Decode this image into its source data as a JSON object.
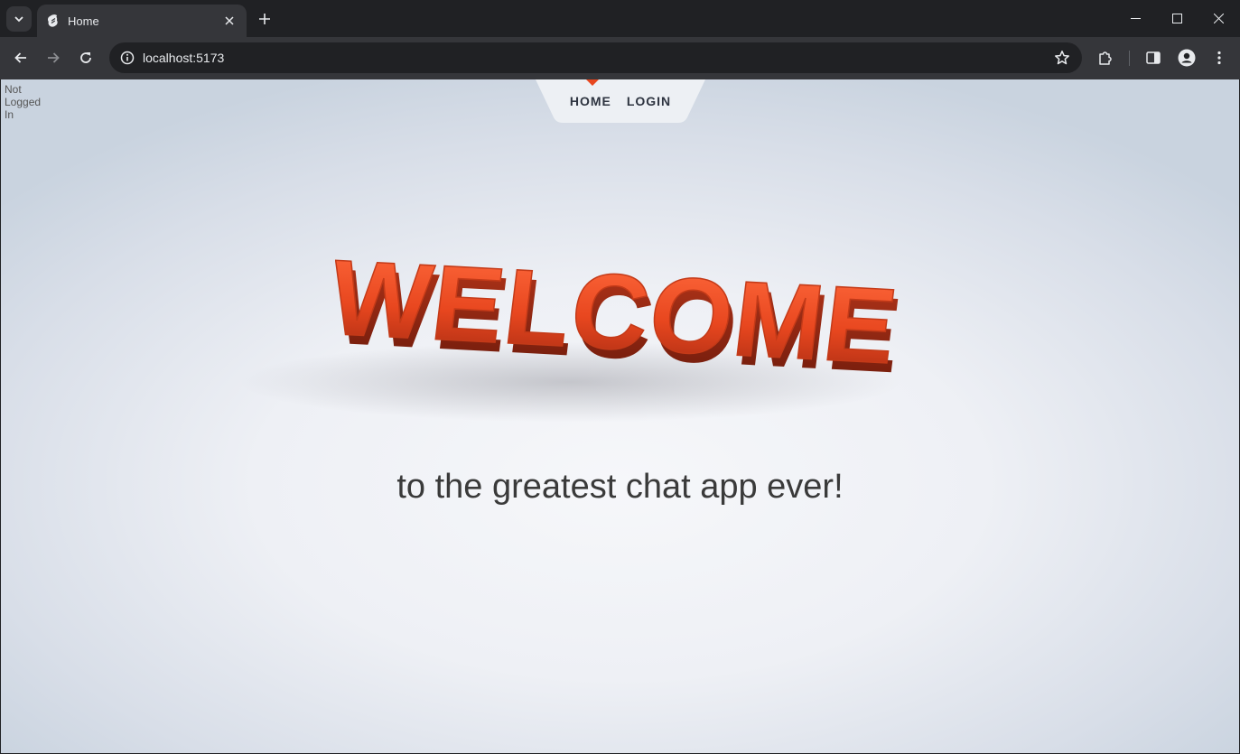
{
  "browser": {
    "tab": {
      "title": "Home"
    },
    "address_bar": {
      "url": "localhost:5173"
    },
    "icons": {
      "tab_search": "chevron-down-icon",
      "favicon": "svelte-icon",
      "tab_close": "close-icon",
      "new_tab": "plus-icon",
      "minimize": "minimize-icon",
      "maximize": "maximize-icon",
      "close_window": "close-icon",
      "back": "arrow-left-icon",
      "forward": "arrow-right-icon",
      "reload": "reload-icon",
      "site_info": "info-icon",
      "bookmark": "star-icon",
      "extensions": "puzzle-icon",
      "side_panel": "side-panel-icon",
      "profile": "person-icon",
      "menu": "kebab-menu-icon"
    }
  },
  "page": {
    "login_status": "Not Logged In",
    "nav": {
      "items": [
        {
          "label": "HOME"
        },
        {
          "label": "LOGIN"
        }
      ]
    },
    "hero_image_text": "WELCOME",
    "tagline": "to the greatest chat app ever!"
  },
  "colors": {
    "accent": "#e8471f",
    "nav_bg": "#edf0f4",
    "text_dark": "#3a3a3a"
  }
}
